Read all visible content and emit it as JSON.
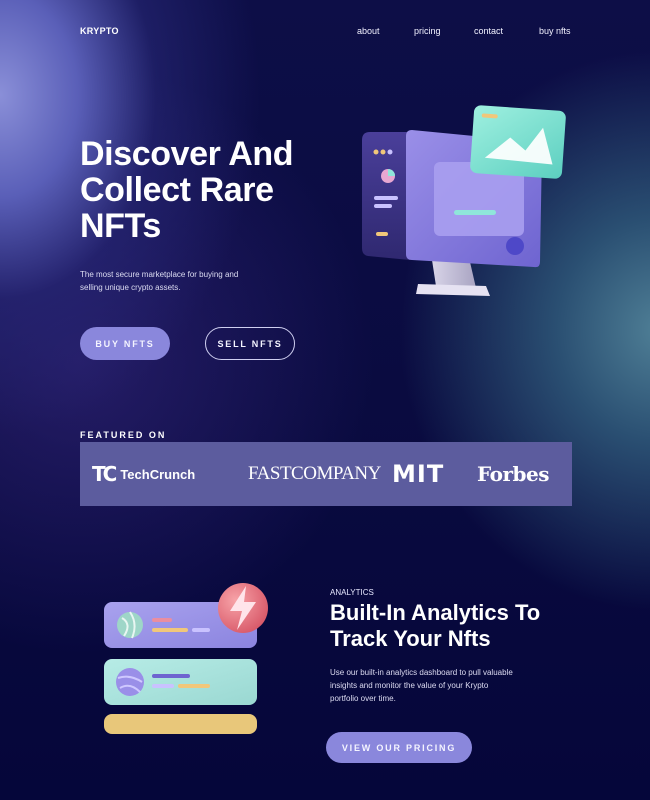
{
  "header": {
    "logo": "KRYPTO",
    "nav": [
      "about",
      "pricing",
      "contact",
      "buy nfts"
    ]
  },
  "hero": {
    "title": "Discover And Collect Rare NFTs",
    "subtitle": "The most secure marketplace for buying and selling unique crypto assets.",
    "buy_button": "BUY NFTS",
    "sell_button": "SELL NFTS",
    "illustration_icon": "computer-monitor-icon"
  },
  "featured": {
    "label": "FEATURED ON",
    "brands": [
      "TechCrunch",
      "FASTCOMPANY",
      "MIT",
      "Forbes"
    ]
  },
  "analytics": {
    "label": "ANALYTICS",
    "title": "Built-In Analytics To Track Your Nfts",
    "subtitle": "Use our built-in analytics dashboard to pull valuable insights and monitor the value of your Krypto portfolio over time.",
    "button": "VIEW OUR PRICING",
    "illustration_icon": "analytics-cards-icon"
  },
  "colors": {
    "accent": "#8a87dc",
    "background": "#0d0e47",
    "featured_bar": "#5c5c9e"
  }
}
